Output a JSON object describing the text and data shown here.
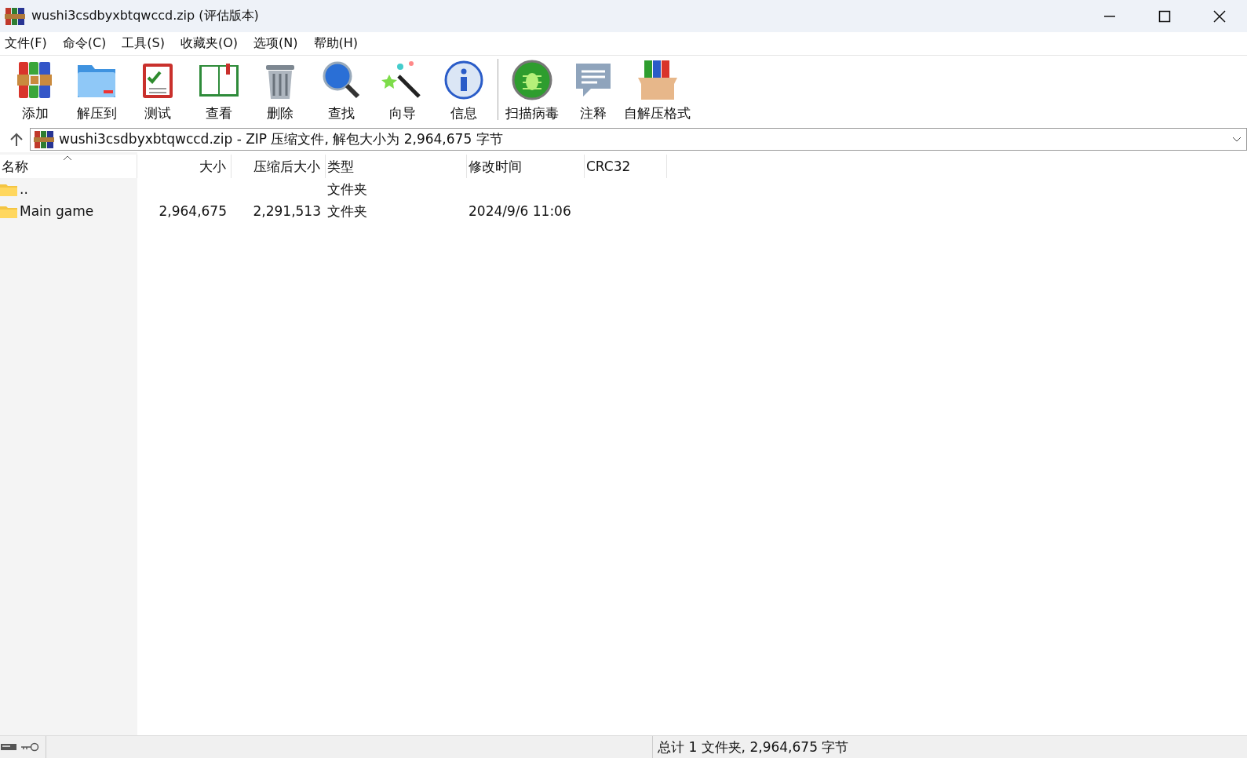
{
  "window": {
    "title": "wushi3csdbyxbtqwccd.zip (评估版本)"
  },
  "menu": [
    "文件(F)",
    "命令(C)",
    "工具(S)",
    "收藏夹(O)",
    "选项(N)",
    "帮助(H)"
  ],
  "toolbar": [
    {
      "label": "添加",
      "kind": "add"
    },
    {
      "label": "解压到",
      "kind": "extract"
    },
    {
      "label": "测试",
      "kind": "test"
    },
    {
      "label": "查看",
      "kind": "view"
    },
    {
      "label": "删除",
      "kind": "delete"
    },
    {
      "label": "查找",
      "kind": "find"
    },
    {
      "label": "向导",
      "kind": "wizard"
    },
    {
      "label": "信息",
      "kind": "info"
    },
    {
      "label": "扫描病毒",
      "kind": "scan",
      "separator_before": true
    },
    {
      "label": "注释",
      "kind": "comment"
    },
    {
      "label": "自解压格式",
      "kind": "sfx"
    }
  ],
  "address": {
    "value": "wushi3csdbyxbtqwccd.zip - ZIP 压缩文件, 解包大小为 2,964,675 字节"
  },
  "table": {
    "columns": [
      {
        "label": "名称",
        "sorted": true
      },
      {
        "label": "大小",
        "sorted": false
      },
      {
        "label": "压缩后大小",
        "sorted": false
      },
      {
        "label": "类型",
        "sorted": false
      },
      {
        "label": "修改时间",
        "sorted": false
      },
      {
        "label": "CRC32",
        "sorted": false
      }
    ],
    "rows": [
      {
        "name": "..",
        "size": "",
        "packed": "",
        "type": "文件夹",
        "modified": "",
        "crc": ""
      },
      {
        "name": "Main game",
        "size": "2,964,675",
        "packed": "2,291,513",
        "type": "文件夹",
        "modified": "2024/9/6 11:06",
        "crc": ""
      }
    ]
  },
  "status_bar": {
    "text": "总计 1 文件夹, 2,964,675 字节"
  }
}
